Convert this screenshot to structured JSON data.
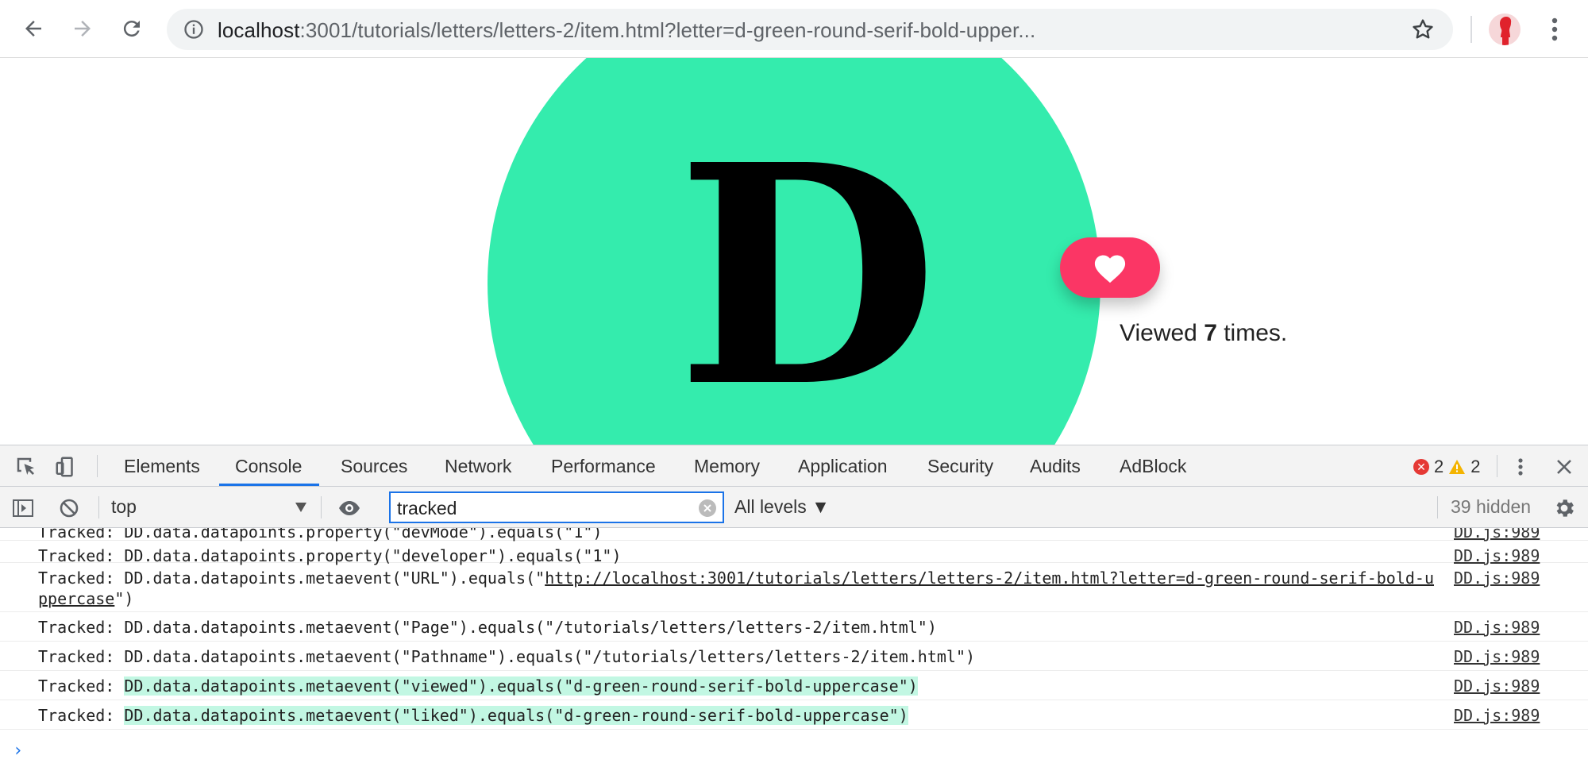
{
  "browser": {
    "url_host": "localhost",
    "url_rest": ":3001/tutorials/letters/letters-2/item.html?letter=d-green-round-serif-bold-upper..."
  },
  "page": {
    "letter": "D",
    "circle_color": "#34ecad",
    "heart_color": "#fb3665",
    "views_prefix": "Viewed ",
    "views_count": "7",
    "views_suffix": " times."
  },
  "devtools": {
    "tabs": [
      "Elements",
      "Console",
      "Sources",
      "Network",
      "Performance",
      "Memory",
      "Application",
      "Security",
      "Audits",
      "AdBlock"
    ],
    "active_tab": "Console",
    "errors": "2",
    "warnings": "2",
    "context": "top",
    "filter": "tracked",
    "levels": "All levels",
    "hidden": "39 hidden",
    "accent": "#1a73e8"
  },
  "console": {
    "rows": [
      {
        "prefix": "Tracked: ",
        "text": "DD.data.datapoints.property(\"devMode\").equals(\"1\")",
        "source": "DD.js:989"
      },
      {
        "prefix": "Tracked: ",
        "text": "DD.data.datapoints.property(\"developer\").equals(\"1\")",
        "source": "DD.js:989"
      },
      {
        "prefix": "Tracked: ",
        "text_a": "DD.data.datapoints.metaevent(\"URL\").equals(\"",
        "link": "http://localhost:3001/tutorials/letters/letters-2/item.html?letter=d-green-round-serif-bold-uppercase",
        "text_b": "\")",
        "source": "DD.js:989"
      },
      {
        "prefix": "Tracked: ",
        "text": "DD.data.datapoints.metaevent(\"Page\").equals(\"/tutorials/letters/letters-2/item.html\")",
        "source": "DD.js:989"
      },
      {
        "prefix": "Tracked: ",
        "text": "DD.data.datapoints.metaevent(\"Pathname\").equals(\"/tutorials/letters/letters-2/item.html\")",
        "source": "DD.js:989"
      },
      {
        "prefix": "Tracked: ",
        "text": "DD.data.datapoints.metaevent(\"viewed\").equals(\"d-green-round-serif-bold-uppercase\")",
        "source": "DD.js:989"
      },
      {
        "prefix": "Tracked: ",
        "text": "DD.data.datapoints.metaevent(\"liked\").equals(\"d-green-round-serif-bold-uppercase\")",
        "source": "DD.js:989"
      }
    ],
    "prompt": "›"
  }
}
